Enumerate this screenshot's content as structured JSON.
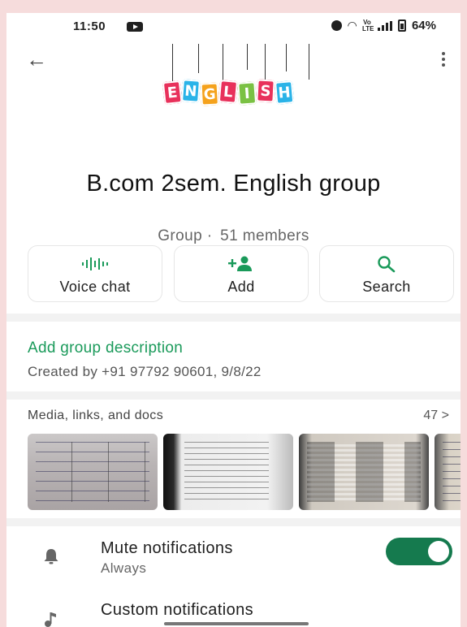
{
  "status_bar": {
    "time": "11:50",
    "network_label": "Vo LTE",
    "battery": "64%"
  },
  "header": {
    "logo_letters": [
      "E",
      "N",
      "G",
      "L",
      "I",
      "S",
      "H"
    ],
    "logo_colors": [
      "#e8315b",
      "#2ab3e8",
      "#f5a21c",
      "#e8315b",
      "#7ac143",
      "#e8315b",
      "#2ab3e8"
    ]
  },
  "group": {
    "name": "B.com 2sem. English group",
    "type": "Group",
    "members": "51 members"
  },
  "actions": [
    {
      "label": "Voice chat",
      "icon": "waveform-icon"
    },
    {
      "label": "Add",
      "icon": "add-person-icon"
    },
    {
      "label": "Search",
      "icon": "search-icon"
    }
  ],
  "description": {
    "add_label": "Add group description",
    "created": "Created by +91 97792 90601, 9/8/22"
  },
  "media": {
    "title": "Media, links, and docs",
    "count": "47 >"
  },
  "settings": [
    {
      "title": "Mute notifications",
      "subtitle": "Always",
      "icon": "bell-icon",
      "toggle_on": true
    },
    {
      "title": "Custom notifications",
      "subtitle": "",
      "icon": "music-note-icon"
    }
  ],
  "colors": {
    "accent": "#1a9a5a",
    "toggle": "#157a4e"
  }
}
